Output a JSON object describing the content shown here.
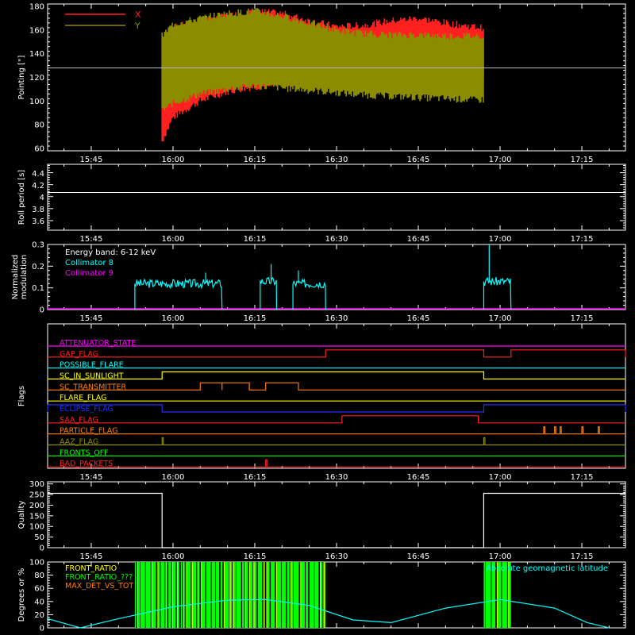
{
  "colors": {
    "background": "#000000",
    "axes": "#ffffff",
    "pointing_x": "#ff2020",
    "pointing_y": "#8c8c00",
    "reference_line": "#bbbbbb",
    "collimator_8": "#00ffff",
    "collimator_9": "#ff00ff",
    "front_ratio": "#ffff00",
    "front_ratio_2": "#00ff00",
    "max_det": "#ff8000",
    "latitude": "#00ffff"
  },
  "chart_data": [
    {
      "id": "pointing",
      "type": "line",
      "ylabel": "Pointing [\"]",
      "xlim": [
        "15:37",
        "17:23"
      ],
      "ylim": [
        58,
        182
      ],
      "yticks": [
        60,
        80,
        100,
        120,
        140,
        160,
        180
      ],
      "xticks": [
        "15:45",
        "16:00",
        "16:15",
        "16:30",
        "16:45",
        "17:00",
        "17:15"
      ],
      "show_xtick_labels": true,
      "legend_position": "top-left",
      "reference_value": 128,
      "data_start": "15:58",
      "data_end": "16:57",
      "series": [
        {
          "name": "X",
          "color": "#ff2020",
          "envelope": [
            {
              "t": "15:58",
              "low": 66,
              "high": 155
            },
            {
              "t": "16:00",
              "low": 86,
              "high": 162
            },
            {
              "t": "16:05",
              "low": 100,
              "high": 168
            },
            {
              "t": "16:10",
              "low": 108,
              "high": 172
            },
            {
              "t": "16:15",
              "low": 112,
              "high": 176
            },
            {
              "t": "16:20",
              "low": 113,
              "high": 174
            },
            {
              "t": "16:25",
              "low": 119,
              "high": 168
            },
            {
              "t": "16:30",
              "low": 122,
              "high": 163
            },
            {
              "t": "16:35",
              "low": 126,
              "high": 164
            },
            {
              "t": "16:40",
              "low": 128,
              "high": 168
            },
            {
              "t": "16:45",
              "low": 128,
              "high": 170
            },
            {
              "t": "16:50",
              "low": 125,
              "high": 166
            },
            {
              "t": "16:55",
              "low": 122,
              "high": 163
            },
            {
              "t": "16:57",
              "low": 121,
              "high": 162
            }
          ]
        },
        {
          "name": "Y",
          "color": "#8c8c00",
          "envelope": [
            {
              "t": "15:58",
              "low": 92,
              "high": 155
            },
            {
              "t": "16:00",
              "low": 98,
              "high": 165
            },
            {
              "t": "16:05",
              "low": 106,
              "high": 170
            },
            {
              "t": "16:10",
              "low": 110,
              "high": 174
            },
            {
              "t": "16:15",
              "low": 113,
              "high": 176
            },
            {
              "t": "16:20",
              "low": 111,
              "high": 172
            },
            {
              "t": "16:25",
              "low": 109,
              "high": 166
            },
            {
              "t": "16:30",
              "low": 107,
              "high": 160
            },
            {
              "t": "16:35",
              "low": 105,
              "high": 157
            },
            {
              "t": "16:40",
              "low": 104,
              "high": 156
            },
            {
              "t": "16:45",
              "low": 103,
              "high": 156
            },
            {
              "t": "16:50",
              "low": 102,
              "high": 155
            },
            {
              "t": "16:55",
              "low": 101,
              "high": 155
            },
            {
              "t": "16:57",
              "low": 101,
              "high": 155
            }
          ]
        }
      ]
    },
    {
      "id": "roll",
      "type": "line",
      "ylabel": "Roll period [s]",
      "xlim": [
        "15:37",
        "17:23"
      ],
      "ylim": [
        3.45,
        4.55
      ],
      "yticks": [
        3.6,
        3.8,
        4.0,
        4.2,
        4.4
      ],
      "xticks": [
        "15:45",
        "16:00",
        "16:15",
        "16:30",
        "16:45",
        "17:00",
        "17:15"
      ],
      "show_xtick_labels": true,
      "series": [
        {
          "name": "",
          "color": "#ffffff",
          "x": [
            "15:37",
            "17:23"
          ],
          "y": [
            4.08,
            4.08
          ]
        }
      ]
    },
    {
      "id": "modulation",
      "type": "line",
      "ylabel": "Normalized modulation",
      "xlim": [
        "15:37",
        "17:23"
      ],
      "ylim": [
        0,
        0.3
      ],
      "yticks": [
        0,
        0.1,
        0.2,
        0.3
      ],
      "xticks": [
        "15:45",
        "16:00",
        "16:15",
        "16:30",
        "16:45",
        "17:00",
        "17:15"
      ],
      "show_xtick_labels": true,
      "annotation": "Energy band: 6-12 keV",
      "legend_position": "top-left",
      "series": [
        {
          "name": "Collimator 8",
          "color": "#00ffff",
          "segments": [
            {
              "start": "15:53",
              "end": "16:09",
              "level": 0.12,
              "spike_t": "16:06",
              "spike_v": 0.17
            },
            {
              "start": "16:16",
              "end": "16:19",
              "level": 0.13,
              "spike_t": "16:18",
              "spike_v": 0.21
            },
            {
              "start": "16:22",
              "end": "16:28",
              "level": 0.12,
              "spike_t": "16:23",
              "spike_v": 0.18
            },
            {
              "start": "16:57",
              "end": "17:02",
              "level": 0.13,
              "spike_t": "16:58",
              "spike_v": 0.3
            }
          ]
        },
        {
          "name": "Collimator 9",
          "color": "#ff00ff",
          "x": [
            "15:37",
            "17:23"
          ],
          "y": [
            0,
            0
          ]
        }
      ]
    },
    {
      "id": "flags",
      "type": "line",
      "ylabel": "Flags",
      "xlim": [
        "15:37",
        "17:23"
      ],
      "xticks": [
        "15:45",
        "16:00",
        "16:15",
        "16:30",
        "16:45",
        "17:00",
        "17:15"
      ],
      "show_xtick_labels": true,
      "rows": [
        {
          "name": "ATTENUATOR_STATE",
          "color": "#ff00ff",
          "events": []
        },
        {
          "name": "GAP_FLAG",
          "color": "#ff2020",
          "events": [
            {
              "t0": "16:28",
              "t1": "16:57"
            },
            {
              "t0": "17:02",
              "t1": "17:23"
            }
          ]
        },
        {
          "name": "POSSIBLE_FLARE",
          "color": "#00ffff",
          "events": []
        },
        {
          "name": "SC_IN_SUNLIGHT",
          "color": "#ffff00",
          "events": [
            {
              "t0": "15:58",
              "t1": "16:57"
            }
          ]
        },
        {
          "name": "SC_TRANSMITTER",
          "color": "#ff8000",
          "events": [
            {
              "t0": "16:05",
              "t1": "16:09"
            },
            {
              "t0": "16:09",
              "t1": "16:14"
            },
            {
              "t0": "16:17",
              "t1": "16:23"
            }
          ]
        },
        {
          "name": "FLARE_FLAG",
          "color": "#ffff00",
          "events": []
        },
        {
          "name": "ECLIPSE_FLAG",
          "color": "#2030ff",
          "events": [
            {
              "t0": "15:37",
              "t1": "15:58"
            },
            {
              "t0": "16:57",
              "t1": "17:23"
            }
          ]
        },
        {
          "name": "SAA_FLAG",
          "color": "#ff2020",
          "events": [
            {
              "t0": "16:31",
              "t1": "16:56"
            }
          ]
        },
        {
          "name": "PARTICLE_FLAG",
          "color": "#ff8000",
          "events": [
            {
              "t0": "17:08",
              "t1": "17:08"
            },
            {
              "t0": "17:10",
              "t1": "17:10"
            },
            {
              "t0": "17:11",
              "t1": "17:11"
            },
            {
              "t0": "17:15",
              "t1": "17:15"
            },
            {
              "t0": "17:18",
              "t1": "17:18"
            }
          ]
        },
        {
          "name": "AAZ_FLAG",
          "color": "#8c8c00",
          "events": [
            {
              "t0": "15:58",
              "t1": "15:58"
            },
            {
              "t0": "16:57",
              "t1": "16:57"
            }
          ]
        },
        {
          "name": "FRONTS_OFF",
          "color": "#00ff00",
          "events": []
        },
        {
          "name": "BAD_PACKETS",
          "color": "#ff2020",
          "events": [
            {
              "t0": "16:17",
              "t1": "16:17"
            }
          ]
        }
      ]
    },
    {
      "id": "quality",
      "type": "line",
      "ylabel": "Quality",
      "xlim": [
        "15:37",
        "17:23"
      ],
      "ylim": [
        0,
        310
      ],
      "yticks": [
        0,
        50,
        100,
        150,
        200,
        250,
        300
      ],
      "xticks": [
        "15:45",
        "16:00",
        "16:15",
        "16:30",
        "16:45",
        "17:00",
        "17:15"
      ],
      "show_xtick_labels": true,
      "series": [
        {
          "name": "",
          "color": "#ffffff",
          "x": [
            "15:37",
            "15:58",
            "15:58",
            "16:57",
            "16:57",
            "17:23"
          ],
          "y": [
            256,
            256,
            0,
            0,
            256,
            256
          ]
        }
      ]
    },
    {
      "id": "ratios",
      "type": "line",
      "ylabel": "Degrees or %",
      "xlim": [
        "15:37",
        "17:23"
      ],
      "ylim": [
        0,
        100
      ],
      "yticks": [
        0,
        20,
        40,
        60,
        80,
        100
      ],
      "xticks": [
        "15:45",
        "16:00",
        "16:15",
        "16:30",
        "16:45",
        "17:00",
        "17:15"
      ],
      "show_xtick_labels": false,
      "legend_position": "top-left",
      "right_legend": "Absolute geomagnetic latitude",
      "series": [
        {
          "name": "FRONT_RATIO",
          "color": "#ffff00",
          "bands": [
            {
              "t0": "15:53",
              "t1": "16:28"
            },
            {
              "t0": "16:57",
              "t1": "17:02"
            }
          ]
        },
        {
          "name": "FRONT_RATIO_???",
          "color": "#00ff00",
          "bands": [
            {
              "t0": "15:53",
              "t1": "16:28"
            },
            {
              "t0": "16:57",
              "t1": "17:02"
            }
          ]
        },
        {
          "name": "MAX_DET_VS_TOT",
          "color": "#ff8000"
        },
        {
          "name": "Absolute geomagnetic latitude",
          "color": "#00ffff",
          "x": [
            "15:37",
            "15:43",
            "15:50",
            "16:00",
            "16:10",
            "16:17",
            "16:25",
            "16:33",
            "16:40",
            "16:50",
            "17:00",
            "17:10",
            "17:16",
            "17:20"
          ],
          "y": [
            14,
            0,
            14,
            32,
            42,
            43,
            34,
            12,
            8,
            30,
            43,
            30,
            8,
            0
          ]
        }
      ]
    }
  ]
}
